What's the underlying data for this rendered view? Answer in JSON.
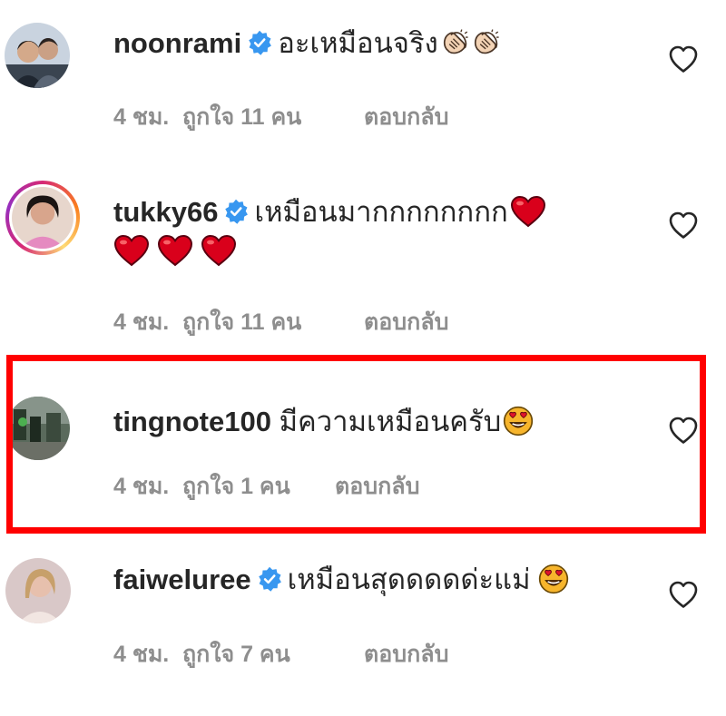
{
  "colors": {
    "verified": "#3897f0",
    "text": "#262626",
    "meta": "#8e8e8e",
    "highlight": "#ff0000",
    "heart_emoji": "#d9001b"
  },
  "icons": {
    "like": "heart-outline-icon",
    "verified": "verified-badge-icon"
  },
  "comments": [
    {
      "username": "noonrami",
      "verified": true,
      "text": "อะเหมือนจริง",
      "emojis": [
        "clapping-hands-emoji",
        "clapping-hands-emoji"
      ],
      "time": "4 ชม.",
      "likes": "ถูกใจ 11 คน",
      "reply": "ตอบกลับ",
      "liked": false
    },
    {
      "username": "tukky66",
      "verified": true,
      "text": "เหมือนมากกกกกกกก",
      "emojis": [
        "red-heart-emoji",
        "red-heart-emoji",
        "red-heart-emoji",
        "red-heart-emoji"
      ],
      "time": "4 ชม.",
      "likes": "ถูกใจ 11 คน",
      "reply": "ตอบกลับ",
      "liked": false,
      "has_story": true
    },
    {
      "username": "tingnote100",
      "verified": false,
      "text": "มีความเหมือนครับ",
      "emojis": [
        "heart-eyes-emoji"
      ],
      "time": "4 ชม.",
      "likes": "ถูกใจ 1 คน",
      "reply": "ตอบกลับ",
      "liked": false,
      "highlighted": true
    },
    {
      "username": "faiweluree",
      "verified": true,
      "text": "เหมือนสุดดดดด่ะแม่",
      "emojis": [
        "heart-eyes-emoji"
      ],
      "time": "4 ชม.",
      "likes": "ถูกใจ 7 คน",
      "reply": "ตอบกลับ",
      "liked": false
    }
  ]
}
